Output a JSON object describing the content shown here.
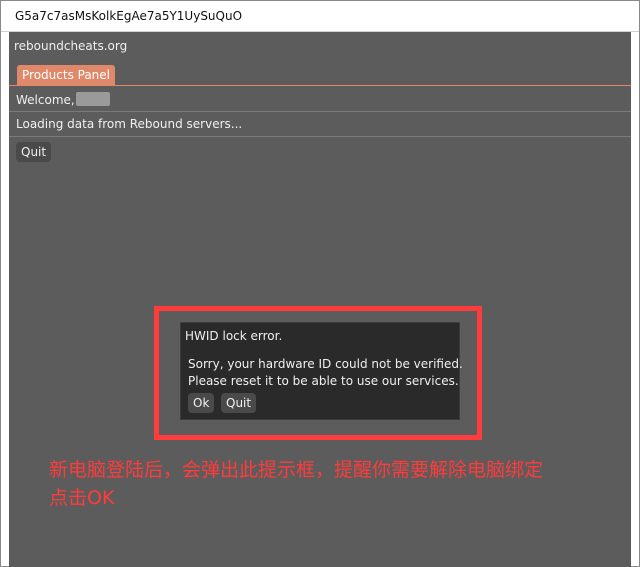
{
  "window": {
    "title": "G5a7c7asMsKolkEgAe7a5Y1UySuQuO"
  },
  "app": {
    "site": "reboundcheats.org",
    "tab_label": "Products Panel",
    "welcome_text": "Welcome,",
    "status_text": "Loading data from Rebound servers...",
    "quit_label": "Quit"
  },
  "modal": {
    "title": "HWID lock error.",
    "message_line1": "Sorry, your hardware ID could not be verified.",
    "message_line2": "Please reset it to be able to use our services.",
    "ok_label": "Ok",
    "quit_label": "Quit"
  },
  "annotation": {
    "line1": "新电脑登陆后，会弹出此提示框，提醒你需要解除电脑绑定",
    "line2": "点击OK",
    "color": "#ff3b3b"
  },
  "colors": {
    "accent": "#e0896a",
    "background": "#5c5c5c",
    "modal_bg": "#2a2a2a",
    "highlight": "#ff3b3b"
  }
}
